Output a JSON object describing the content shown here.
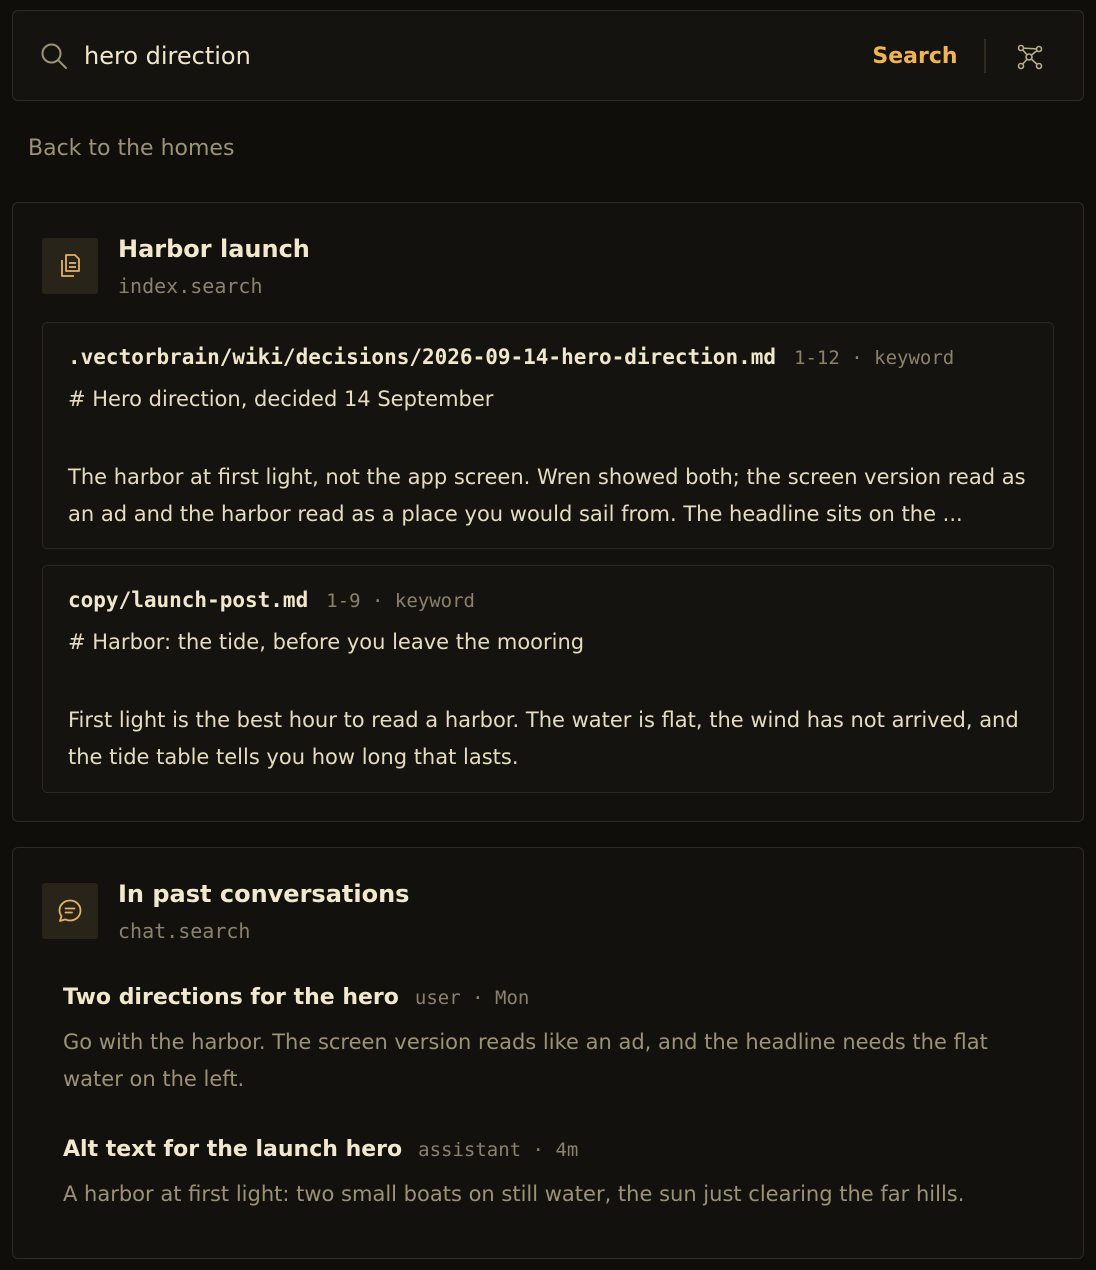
{
  "search": {
    "value": "hero direction",
    "button_label": "Search",
    "icon": "search-icon",
    "graph_icon": "graph-icon"
  },
  "back_link": "Back to the homes",
  "index_panel": {
    "title": "Harbor launch",
    "subtitle": "index.search",
    "icon": "documents-icon",
    "results": [
      {
        "path": ".vectorbrain/wiki/decisions/2026-09-14-hero-direction.md",
        "lines": "1-12",
        "separator": "·",
        "match": "keyword",
        "heading": "# Hero direction, decided 14 September",
        "body": "The harbor at first light, not the app screen. Wren showed both; the screen version read as an ad and the harbor read as a place you would sail from. The headline sits on the ..."
      },
      {
        "path": "copy/launch-post.md",
        "lines": "1-9",
        "separator": "·",
        "match": "keyword",
        "heading": "# Harbor: the tide, before you leave the mooring",
        "body": "First light is the best hour to read a harbor. The water is flat, the wind has not arrived, and the tide table tells you how long that lasts."
      }
    ]
  },
  "chat_panel": {
    "title": "In past conversations",
    "subtitle": "chat.search",
    "icon": "chat-bubble-icon",
    "items": [
      {
        "title": "Two directions for the hero",
        "role": "user",
        "separator": "·",
        "time": "Mon",
        "body": "Go with the harbor. The screen version reads like an ad, and the headline needs the flat water on the left."
      },
      {
        "title": "Alt text for the launch hero",
        "role": "assistant",
        "separator": "·",
        "time": "4m",
        "body": "A harbor at first light: two small boats on still water, the sun just clearing the far hills."
      }
    ]
  },
  "colors": {
    "background": "#0f0e0b",
    "accent": "#f0b552",
    "border": "#2e2b22",
    "muted": "#9d9276"
  }
}
